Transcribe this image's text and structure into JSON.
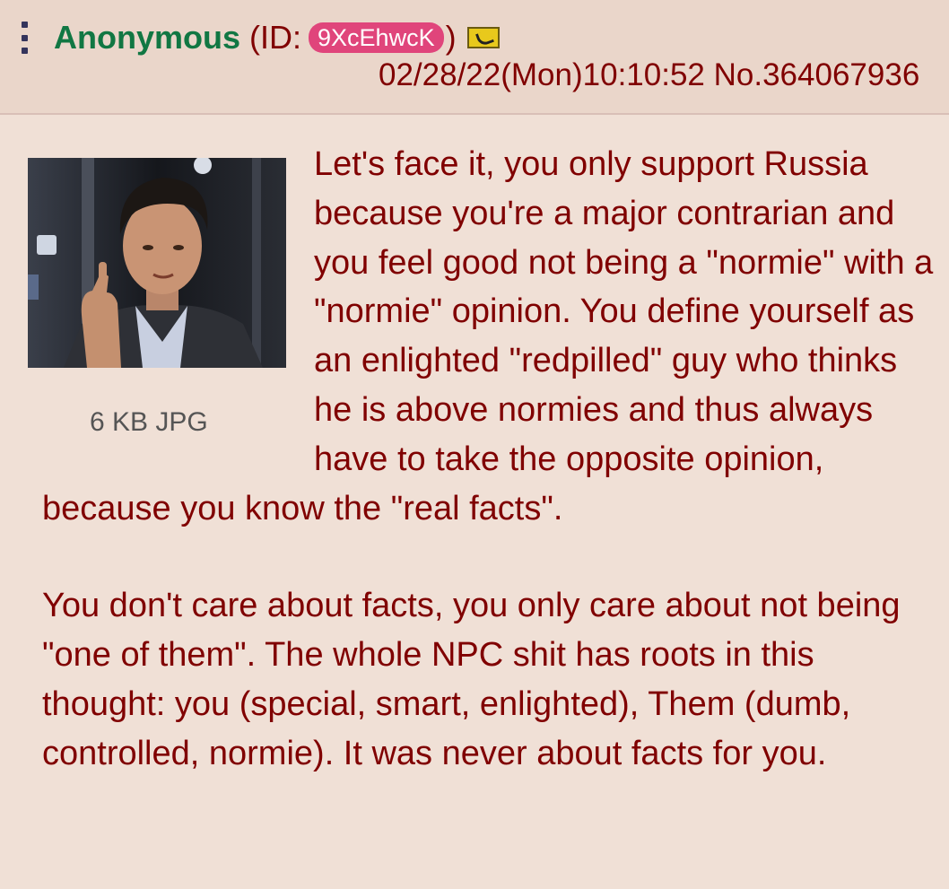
{
  "post": {
    "poster_name": "Anonymous",
    "id_open": "(ID:",
    "poster_id": "9XcEhwcK",
    "id_close": ")",
    "flag_icon": "gadsden-flag-icon",
    "datetime": "02/28/22(Mon)10:10:52",
    "post_number": "No.364067936",
    "file_info": "6 KB JPG",
    "comment_paragraphs": [
      "Let's face it, you only support Russia because you're a major contrarian and you feel good not being a \"normie\" with a \"normie\" opinion. You define yourself as an enlighted \"redpilled\" guy who thinks he is above normies and thus always have to take the opposite opinion, because you know the \"real facts\".",
      "You don't care about facts, you only care about not being \"one of them\". The whole NPC shit has roots in this thought: you (special, smart, enlighted), Them (dumb, controlled, normie). It was never about facts for you."
    ]
  },
  "colors": {
    "background": "#f0e0d6",
    "header_background": "#ead6ca",
    "name": "#117743",
    "text": "#800000",
    "id_badge": "#e0457b"
  }
}
